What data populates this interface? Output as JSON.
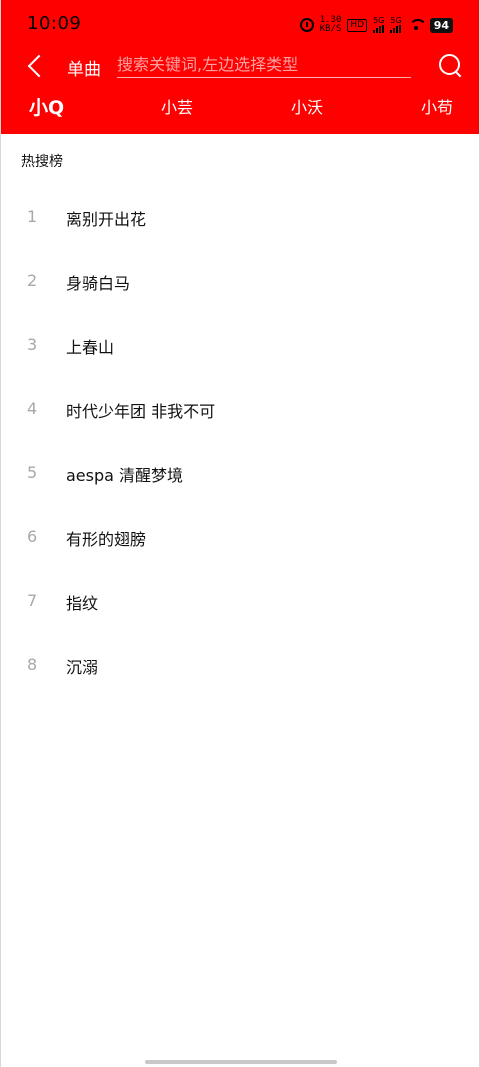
{
  "status": {
    "time": "10:09",
    "net_speed_value": "1.30",
    "net_speed_unit": "KB/S",
    "hd_badge": "HD",
    "signal1_label": "5G",
    "signal2_label": "5G",
    "battery": "94"
  },
  "toolbar": {
    "type_label": "单曲",
    "search_placeholder": "搜索关键词,左边选择类型"
  },
  "tabs": [
    {
      "label": "小Q"
    },
    {
      "label": "小芸"
    },
    {
      "label": "小沃"
    },
    {
      "label": "小苟"
    }
  ],
  "hot": {
    "title": "热搜榜",
    "items": [
      {
        "index": "1",
        "title": "离别开出花"
      },
      {
        "index": "2",
        "title": "身骑白马"
      },
      {
        "index": "3",
        "title": "上春山"
      },
      {
        "index": "4",
        "title": "时代少年团 非我不可"
      },
      {
        "index": "5",
        "title": "aespa 清醒梦境"
      },
      {
        "index": "6",
        "title": "有形的翅膀"
      },
      {
        "index": "7",
        "title": "指纹"
      },
      {
        "index": "8",
        "title": "沉溺"
      }
    ]
  },
  "colors": {
    "header_bg": "#fe0000",
    "index_text": "#a8a8a8",
    "title_text": "#111111"
  }
}
